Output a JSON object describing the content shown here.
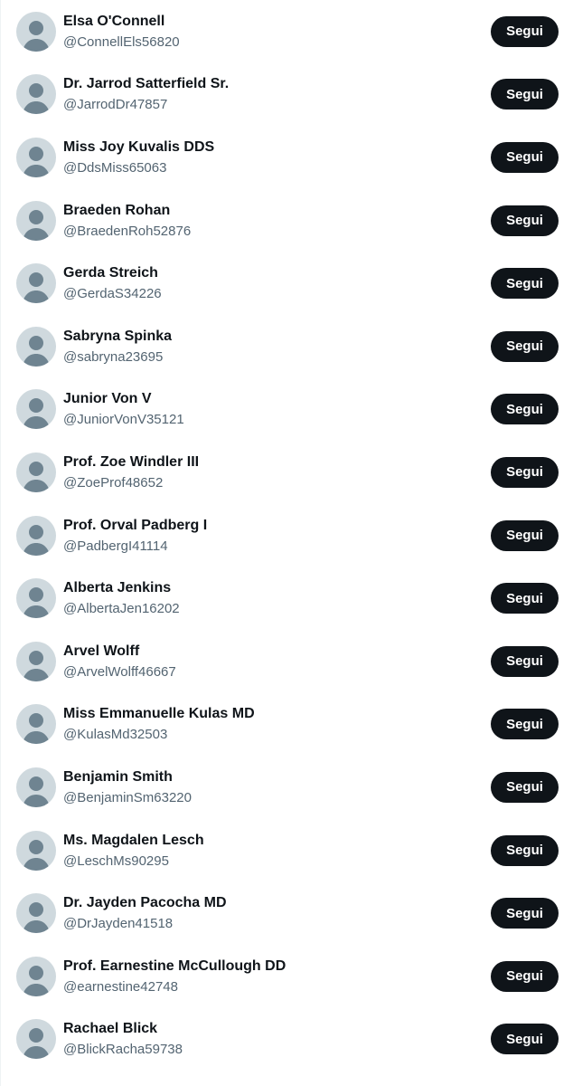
{
  "follow_label": "Segui",
  "colors": {
    "button_bg": "#0f1419",
    "button_text": "#ffffff",
    "name_text": "#0f1419",
    "handle_text": "#536471",
    "avatar_bg": "#cfd9de",
    "avatar_figure": "#6f8491"
  },
  "icons": {
    "avatar": "default-profile-icon"
  },
  "users": [
    {
      "name": "Elsa O'Connell",
      "handle": "@ConnellEls56820"
    },
    {
      "name": "Dr. Jarrod Satterfield Sr.",
      "handle": "@JarrodDr47857"
    },
    {
      "name": "Miss Joy Kuvalis DDS",
      "handle": "@DdsMiss65063"
    },
    {
      "name": "Braeden Rohan",
      "handle": "@BraedenRoh52876"
    },
    {
      "name": "Gerda Streich",
      "handle": "@GerdaS34226"
    },
    {
      "name": "Sabryna Spinka",
      "handle": "@sabryna23695"
    },
    {
      "name": "Junior Von V",
      "handle": "@JuniorVonV35121"
    },
    {
      "name": "Prof. Zoe Windler III",
      "handle": "@ZoeProf48652"
    },
    {
      "name": "Prof. Orval Padberg I",
      "handle": "@PadbergI41114"
    },
    {
      "name": "Alberta Jenkins",
      "handle": "@AlbertaJen16202"
    },
    {
      "name": "Arvel Wolff",
      "handle": "@ArvelWolff46667"
    },
    {
      "name": "Miss Emmanuelle Kulas MD",
      "handle": "@KulasMd32503"
    },
    {
      "name": "Benjamin Smith",
      "handle": "@BenjaminSm63220"
    },
    {
      "name": "Ms. Magdalen Lesch",
      "handle": "@LeschMs90295"
    },
    {
      "name": "Dr. Jayden Pacocha MD",
      "handle": "@DrJayden41518"
    },
    {
      "name": "Prof. Earnestine McCullough DD",
      "handle": "@earnestine42748"
    },
    {
      "name": "Rachael Blick",
      "handle": "@BlickRacha59738"
    }
  ]
}
